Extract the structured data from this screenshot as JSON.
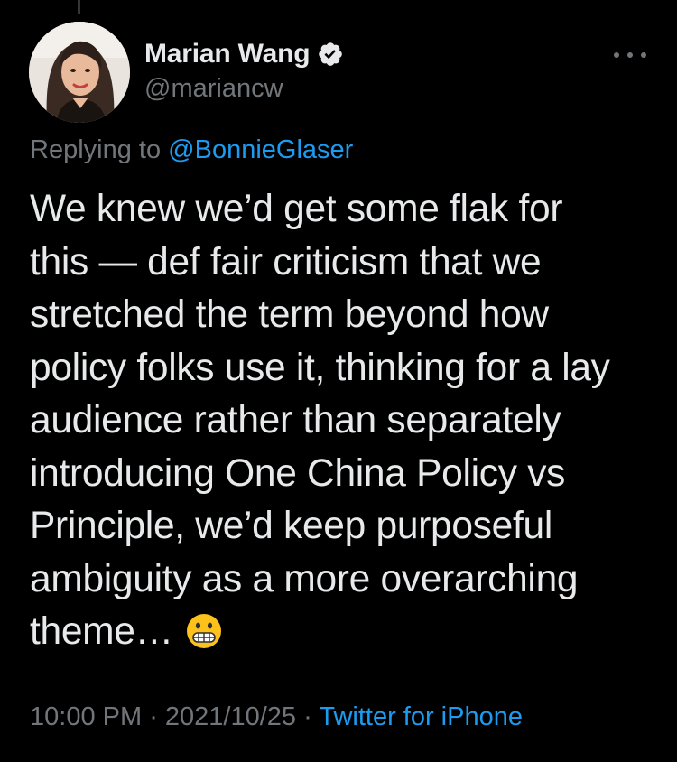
{
  "tweet": {
    "author": {
      "name": "Marian Wang",
      "handle": "@mariancw",
      "verified": true
    },
    "reply": {
      "prefix": "Replying to ",
      "mention": "@BonnieGlaser"
    },
    "text_lines": [
      "We knew we’d get some flak for",
      "this — def fair criticism that we",
      "stretched the term beyond how",
      "policy folks use it, thinking for a lay",
      "audience rather than separately",
      "introducing One China Policy vs",
      "Principle, we’d keep purposeful",
      "ambiguity as a more overarching",
      "theme…"
    ],
    "emoji": "grimacing-face",
    "time": "10:00 PM",
    "separator": " · ",
    "date": "2021/10/25",
    "source": "Twitter for iPhone"
  },
  "icons": {
    "verified": "verified-badge-icon",
    "more": "more-dots-icon"
  },
  "colors": {
    "background": "#000000",
    "text": "#e7e9ea",
    "secondary": "#71767b",
    "link": "#1d9bf0"
  }
}
